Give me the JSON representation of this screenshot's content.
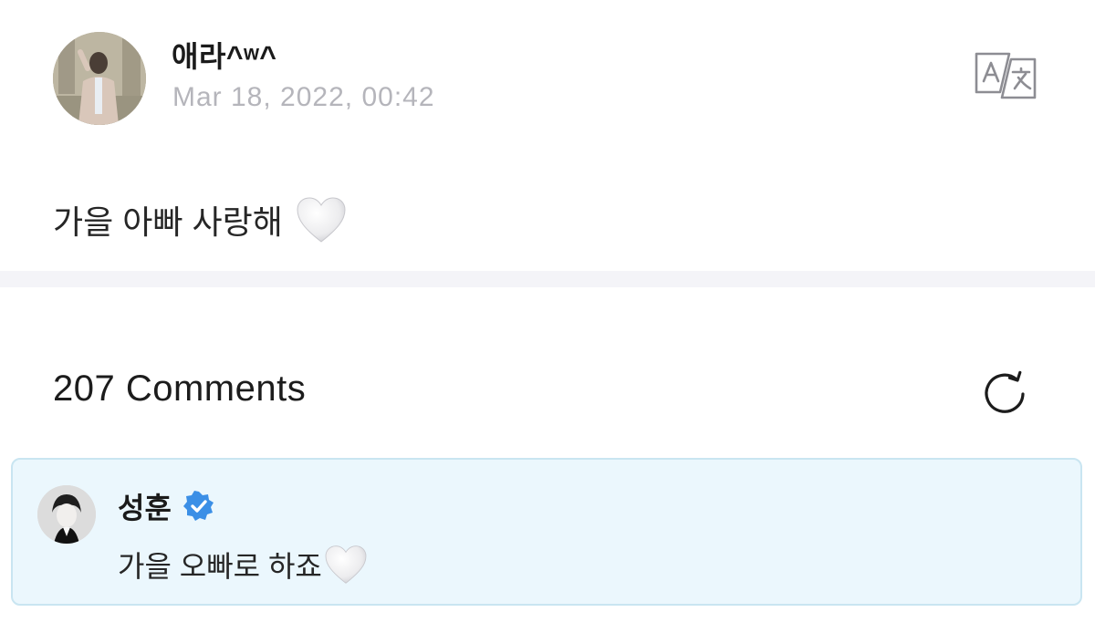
{
  "post": {
    "author": "애라^ʷ^",
    "timestamp": "Mar 18, 2022, 00:42",
    "body": "가을 아빠 사랑해",
    "body_emoji": "white-heart-icon"
  },
  "comments": {
    "title": "207 Comments",
    "items": [
      {
        "author": "성훈",
        "verified": true,
        "text": "가을 오빠로 하죠",
        "text_emoji": "white-heart-icon"
      }
    ]
  },
  "colors": {
    "verified_badge": "#3b8fe6",
    "comment_highlight_bg": "#ebf7fd",
    "comment_highlight_border": "#c9e5f1",
    "timestamp": "#b5b5bb"
  }
}
